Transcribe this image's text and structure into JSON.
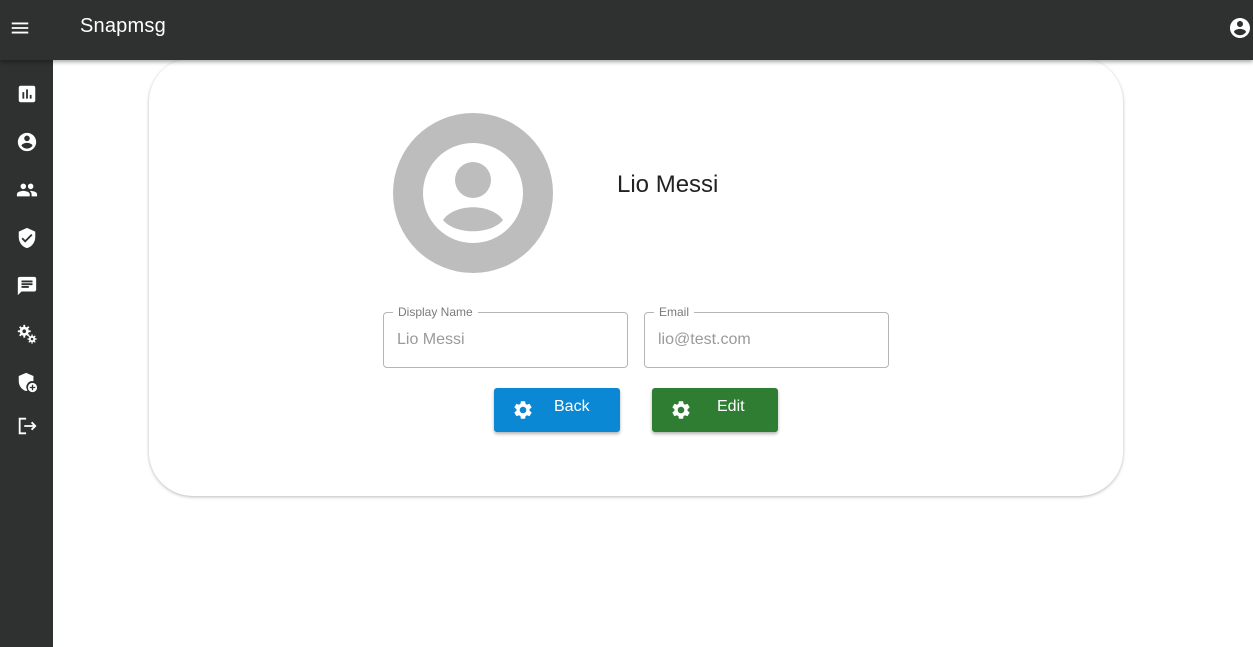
{
  "app": {
    "title": "Snapmsg",
    "colors": {
      "appbar": "#2f3130",
      "back_button": "#0a88d4",
      "edit_button": "#2e7d32"
    }
  },
  "header": {
    "menu_icon": "hamburger-menu-icon",
    "account_icon": "account-circle-icon"
  },
  "sidebar": {
    "items": [
      {
        "icon": "dashboard-chart-icon"
      },
      {
        "icon": "account-circle-icon"
      },
      {
        "icon": "people-icon"
      },
      {
        "icon": "verified-shield-icon"
      },
      {
        "icon": "chat-message-icon"
      },
      {
        "icon": "settings-gears-icon"
      },
      {
        "icon": "shield-add-icon"
      },
      {
        "icon": "logout-icon"
      }
    ]
  },
  "profile": {
    "avatar_icon": "default-avatar-icon",
    "name": "Lio Messi",
    "fields": {
      "display_name": {
        "label": "Display Name",
        "placeholder": "Lio Messi"
      },
      "email": {
        "label": "Email",
        "placeholder": "lio@test.com"
      }
    },
    "buttons": {
      "back": {
        "label": "Back",
        "icon": "gear-icon"
      },
      "edit": {
        "label": "Edit",
        "icon": "gear-icon"
      }
    }
  }
}
